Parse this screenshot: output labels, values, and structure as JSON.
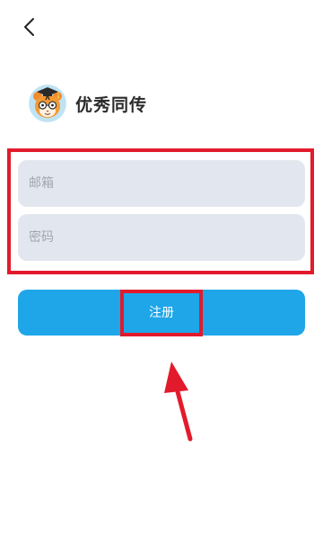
{
  "app": {
    "name": "优秀同传"
  },
  "form": {
    "email_placeholder": "邮箱",
    "password_placeholder": "密码",
    "submit_label": "注册"
  },
  "icons": {
    "back": "chevron-left-icon",
    "logo": "tiger-mascot-logo"
  },
  "colors": {
    "primary_button": "#1fa6e8",
    "input_background": "#e2e7ef",
    "annotation": "#e21b2c"
  }
}
